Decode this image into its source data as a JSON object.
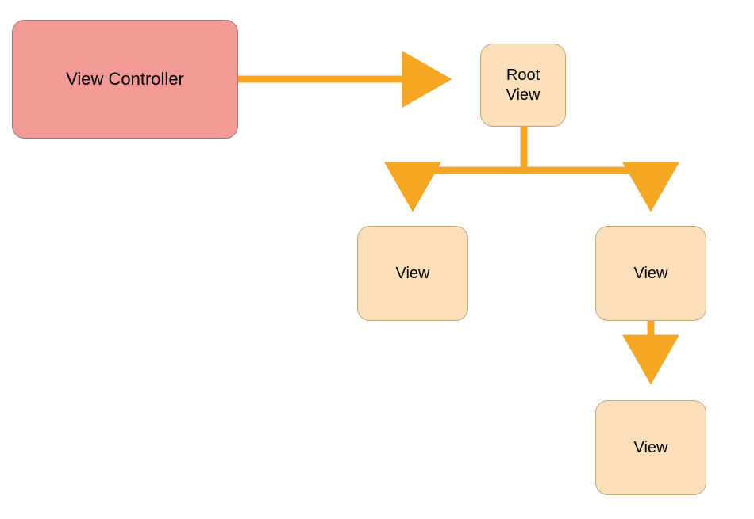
{
  "diagram": {
    "nodes": {
      "viewController": {
        "label": "View Controller"
      },
      "rootView": {
        "label": "Root\nView"
      },
      "viewLeft": {
        "label": "View"
      },
      "viewRight": {
        "label": "View"
      },
      "viewBottom": {
        "label": "View"
      }
    },
    "colors": {
      "controller_fill": "#f29b96",
      "controller_border": "#a87272",
      "view_fill": "#fbdfbb",
      "view_border": "#c9a779",
      "arrow": "#f5a623"
    },
    "edges": [
      {
        "from": "viewController",
        "to": "rootView"
      },
      {
        "from": "rootView",
        "to": "viewLeft"
      },
      {
        "from": "rootView",
        "to": "viewRight"
      },
      {
        "from": "viewRight",
        "to": "viewBottom"
      }
    ]
  }
}
